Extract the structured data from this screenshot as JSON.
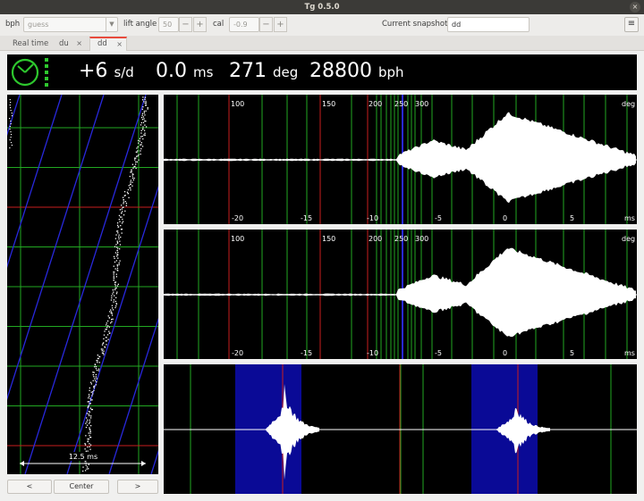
{
  "window": {
    "title": "Tg 0.5.0",
    "close_glyph": "×"
  },
  "toolbar": {
    "bph_label": "bph",
    "bph_value": "guess",
    "lift_angle_label": "lift angle",
    "lift_angle_value": "50",
    "cal_label": "cal",
    "cal_value": "-0.9",
    "snapshot_label": "Current snapshot:",
    "snapshot_value": "dd",
    "minus": "−",
    "plus": "+",
    "menu_glyph": "≡"
  },
  "tabs": [
    {
      "label": "Real time",
      "closable": false
    },
    {
      "label": "du",
      "closable": true
    },
    {
      "label": "dd",
      "closable": true,
      "selected": true
    }
  ],
  "tab_close_glyph": "×",
  "status": {
    "rate": "+6",
    "rate_unit": "s/d",
    "beat_error": "0.0",
    "beat_error_unit": "ms",
    "amplitude": "271",
    "amplitude_unit": "deg",
    "bph": "28800",
    "bph_unit": "bph",
    "indicator_color": "#2ec82e"
  },
  "paperstrip": {
    "scale_label": "12.5 ms",
    "left_button": "<",
    "center_button": "Center",
    "right_button": ">"
  },
  "waveforms": {
    "deg_ticks": [
      "100",
      "150",
      "200",
      "250",
      "300"
    ],
    "deg_unit": "deg",
    "ms_ticks": [
      "-20",
      "-15",
      "-10",
      "-5",
      "0",
      "5"
    ],
    "ms_unit": "ms"
  },
  "colors": {
    "grid_green": "#22a822",
    "grid_red": "#c81e1e",
    "highlight_blue": "#2828dc",
    "wave_white": "#ffffff",
    "period_blue": "#0a0a96"
  }
}
